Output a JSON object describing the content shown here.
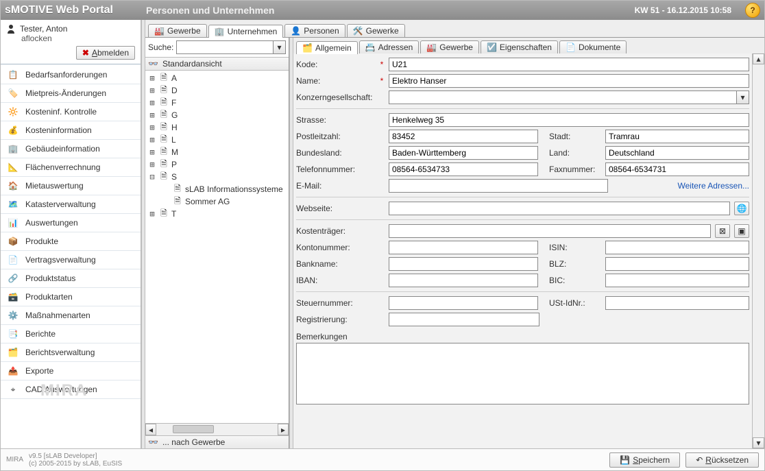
{
  "header": {
    "brand": "sMOTIVE Web Portal",
    "title": "Personen und Unternehmen",
    "date": "KW 51 - 16.12.2015 10:58",
    "help_tooltip": "?"
  },
  "user": {
    "name": "Tester, Anton",
    "flocken": "aflocken",
    "logout_label": "Abmelden"
  },
  "nav": {
    "items": [
      {
        "label": "Bedarfsanforderungen",
        "icon": "clipboard"
      },
      {
        "label": "Mietpreis-Änderungen",
        "icon": "price"
      },
      {
        "label": "Kosteninf. Kontrolle",
        "icon": "gauge"
      },
      {
        "label": "Kosteninformation",
        "icon": "coins"
      },
      {
        "label": "Gebäudeinformation",
        "icon": "building"
      },
      {
        "label": "Flächenverrechnung",
        "icon": "area"
      },
      {
        "label": "Mietauswertung",
        "icon": "house-chart"
      },
      {
        "label": "Katasterverwaltung",
        "icon": "map"
      },
      {
        "label": "Auswertungen",
        "icon": "bar-chart"
      },
      {
        "label": "Produkte",
        "icon": "box"
      },
      {
        "label": "Vertragsverwaltung",
        "icon": "contract"
      },
      {
        "label": "Produktstatus",
        "icon": "link"
      },
      {
        "label": "Produktarten",
        "icon": "boxes"
      },
      {
        "label": "Maßnahmenarten",
        "icon": "gear"
      },
      {
        "label": "Berichte",
        "icon": "report"
      },
      {
        "label": "Berichtsverwaltung",
        "icon": "report-admin"
      },
      {
        "label": "Exporte",
        "icon": "export"
      },
      {
        "label": "CAD Auswertungen",
        "icon": "cad"
      }
    ],
    "watermark": "MIRA"
  },
  "module_tabs": [
    {
      "label": "Gewerbe",
      "icon": "factory",
      "active": false
    },
    {
      "label": "Unternehmen",
      "icon": "company",
      "active": true
    },
    {
      "label": "Personen",
      "icon": "person",
      "active": false
    },
    {
      "label": "Gewerke",
      "icon": "tools",
      "active": false
    }
  ],
  "tree": {
    "search_label": "Suche:",
    "head_label": "Standardansicht",
    "foot_label": "... nach Gewerbe",
    "nodes": [
      {
        "exp": "⊞",
        "label": "A"
      },
      {
        "exp": "⊞",
        "label": "D"
      },
      {
        "exp": "⊞",
        "label": "F"
      },
      {
        "exp": "⊞",
        "label": "G"
      },
      {
        "exp": "⊞",
        "label": "H"
      },
      {
        "exp": "⊞",
        "label": "L"
      },
      {
        "exp": "⊞",
        "label": "M"
      },
      {
        "exp": "⊞",
        "label": "P"
      },
      {
        "exp": "⊟",
        "label": "S",
        "children": [
          {
            "label": "sLAB Informationssysteme"
          },
          {
            "label": "Sommer AG"
          }
        ]
      },
      {
        "exp": "⊞",
        "label": "T"
      }
    ]
  },
  "detail_tabs": [
    {
      "label": "Allgemein",
      "icon": "card",
      "active": true
    },
    {
      "label": "Adressen",
      "icon": "addressbook",
      "active": false
    },
    {
      "label": "Gewerbe",
      "icon": "factory",
      "active": false
    },
    {
      "label": "Eigenschaften",
      "icon": "properties",
      "active": false
    },
    {
      "label": "Dokumente",
      "icon": "document",
      "active": false
    }
  ],
  "form": {
    "kode": {
      "label": "Kode:",
      "value": "U21",
      "required": true
    },
    "name": {
      "label": "Name:",
      "value": "Elektro Hanser",
      "required": true
    },
    "konzern": {
      "label": "Konzerngesellschaft:",
      "value": ""
    },
    "strasse": {
      "label": "Strasse:",
      "value": "Henkelweg 35"
    },
    "plz": {
      "label": "Postleitzahl:",
      "value": "83452"
    },
    "stadt": {
      "label": "Stadt:",
      "value": "Tramrau"
    },
    "bundesland": {
      "label": "Bundesland:",
      "value": "Baden-Württemberg"
    },
    "land": {
      "label": "Land:",
      "value": "Deutschland"
    },
    "tel": {
      "label": "Telefonnummer:",
      "value": "08564-6534733"
    },
    "fax": {
      "label": "Faxnummer:",
      "value": "08564-6534731"
    },
    "email": {
      "label": "E-Mail:",
      "value": ""
    },
    "more_addr": "Weitere Adressen...",
    "web": {
      "label": "Webseite:",
      "value": ""
    },
    "kostentraeger": {
      "label": "Kostenträger:",
      "value": ""
    },
    "konto": {
      "label": "Kontonummer:",
      "value": ""
    },
    "isin": {
      "label": "ISIN:",
      "value": ""
    },
    "bank": {
      "label": "Bankname:",
      "value": ""
    },
    "blz": {
      "label": "BLZ:",
      "value": ""
    },
    "iban": {
      "label": "IBAN:",
      "value": ""
    },
    "bic": {
      "label": "BIC:",
      "value": ""
    },
    "steuer": {
      "label": "Steuernummer:",
      "value": ""
    },
    "ust": {
      "label": "USt-IdNr.:",
      "value": ""
    },
    "reg": {
      "label": "Registrierung:",
      "value": ""
    },
    "bemerkungen": {
      "label": "Bemerkungen"
    }
  },
  "footer": {
    "version": "v9.5 [sLAB Developer]",
    "copyright": "(c) 2005-2015 by sLAB, EuSIS",
    "logo": "MIRA",
    "save": "Speichern",
    "reset": "Rücksetzen"
  }
}
